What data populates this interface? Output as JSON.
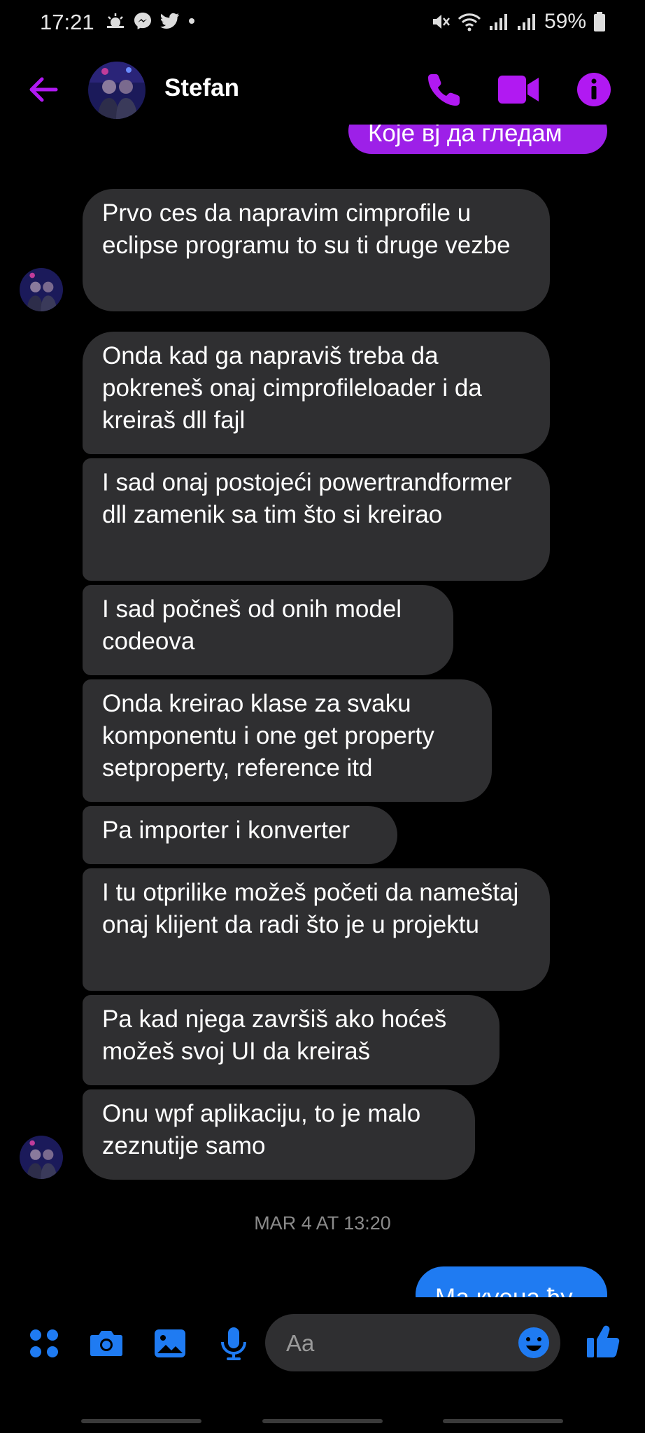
{
  "status_bar": {
    "time": "17:21",
    "battery": "59%",
    "left_icons": [
      "weather-icon",
      "messenger-icon",
      "twitter-icon",
      "dot-icon"
    ],
    "right_icons": [
      "mute-icon",
      "wifi-icon",
      "signal-icon",
      "signal-icon",
      "battery-icon"
    ]
  },
  "header": {
    "contact_name": "Stefan",
    "accent_color": "#b119f2"
  },
  "messages": {
    "out_top": "Које вј да гледам",
    "group1": [
      "Prvo ces da napravim cimprofile u eclipse programu to su ti druge vezbe"
    ],
    "group2": [
      "Onda kad ga napraviš treba da pokreneš onaj cimprofileloader i da kreiraš dll fajl",
      "I sad onaj postojeći powertrandformer dll zamenik sa tim što si kreirao",
      "I sad počneš od onih model codeova",
      "Onda kreirao klase za svaku komponentu i one get property setproperty, reference itd",
      "Pa importer i konverter",
      "I tu otprilike možeš početi da nameštaj onaj klijent da radi što je u projektu",
      "Pa kad njega završiš ako hoćeš možeš svoj UI da kreiraš",
      "Onu wpf aplikaciju, to je malo zeznutije samo"
    ],
    "timestamp": "MAR 4 AT 13:20",
    "out_bottom": "Ма кyeua ђу"
  },
  "composer": {
    "placeholder": "Aa"
  },
  "colors": {
    "outgoing_purple": "#9d20e8",
    "outgoing_blue": "#1f7bf2",
    "incoming_bubble": "#2f2f31",
    "composer_icons": "#1f7bf2"
  }
}
